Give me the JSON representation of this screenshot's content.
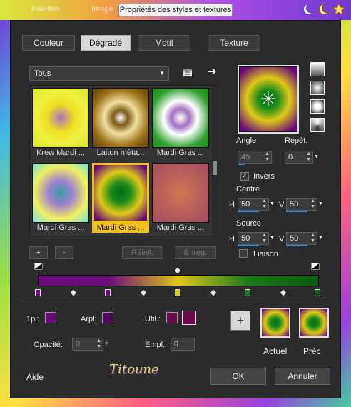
{
  "topbar": {
    "ghost_menu_1": "Palettes",
    "ghost_menu_2": "Image",
    "title": "Propriétés des styles et textures"
  },
  "tabs": [
    {
      "label": "Couleur"
    },
    {
      "label": "Dégradé"
    },
    {
      "label": "Motif"
    },
    {
      "label": "Texture"
    }
  ],
  "category_select": {
    "value": "Tous"
  },
  "thumbnails": [
    {
      "label": "Krew Mardi ..."
    },
    {
      "label": "Laiton méta..."
    },
    {
      "label": "Mardi Gras ..."
    },
    {
      "label": "Mardi Gras ..."
    },
    {
      "label": "Mardi Gras ..."
    },
    {
      "label": "Mardi Gras ..."
    }
  ],
  "list_buttons": {
    "add": "+",
    "remove": "-",
    "reset": "Réinit.",
    "save": "Enreg."
  },
  "angle": {
    "label": "Angle",
    "value": "45"
  },
  "repeat": {
    "label": "Répét.",
    "value": "0"
  },
  "invert": {
    "label": "Invers",
    "checked": true
  },
  "center": {
    "label": "Centre",
    "h_label": "H",
    "h_value": "50",
    "v_label": "V",
    "v_value": "50"
  },
  "source": {
    "label": "Source",
    "h_label": "H",
    "h_value": "50",
    "v_label": "V",
    "v_value": "50"
  },
  "link": {
    "label": "Liaison",
    "checked": false
  },
  "stop_fields": {
    "fg_label": "1pl:",
    "bg_label": "Arpl:",
    "user_label": "Util.:",
    "opacity_label": "Opacité:",
    "opacity_value": "0",
    "location_label": "Empl.:",
    "location_value": "0"
  },
  "compare": {
    "current_label": "Actuel",
    "previous_label": "Préc."
  },
  "footer": {
    "help": "Aide",
    "logo_text": "Titoune",
    "ok": "OK",
    "cancel": "Annuler"
  },
  "colors": {
    "purple": "#6a0a78",
    "yellow": "#e8c818",
    "green": "#1a7a1a",
    "accent_blue": "#3a8ad0",
    "selection": "#f0c020"
  }
}
